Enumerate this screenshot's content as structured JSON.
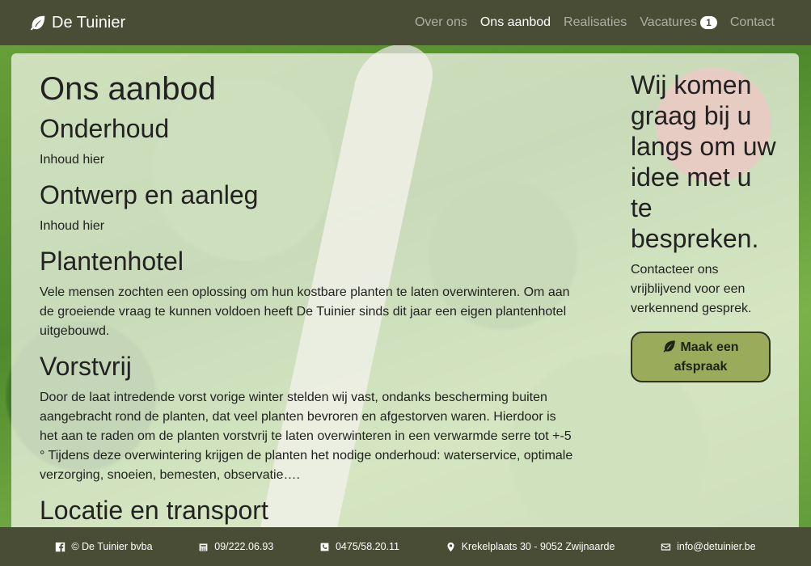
{
  "brand": {
    "name": "De Tuinier",
    "icon": "leaf-icon"
  },
  "nav": {
    "items": [
      {
        "label": "Over ons"
      },
      {
        "label": "Ons aanbod"
      },
      {
        "label": "Realisaties"
      },
      {
        "label": "Vacatures",
        "badge": "1"
      },
      {
        "label": "Contact"
      }
    ]
  },
  "main": {
    "title": "Ons aanbod",
    "sections": [
      {
        "heading": "Onderhoud",
        "text": "Inhoud hier"
      },
      {
        "heading": "Ontwerp en aanleg",
        "text": "Inhoud hier"
      },
      {
        "heading": "Plantenhotel",
        "text": "Vele mensen zochten een oplossing om hun kostbare planten te laten overwinteren. Om aan de groeiende vraag te kunnen voldoen heeft De Tuinier sinds dit jaar een eigen plantenhotel uitgebouwd."
      },
      {
        "heading": "Vorstvrij",
        "text": "Door de laat intredende vorst vorige winter stelden wij vast, ondanks bescherming buiten aangebracht rond de planten, dat veel planten bevroren en afgestorven waren. Hierdoor is het aan te raden om de planten vorstvrij te laten overwinteren in een verwarmde serre tot +-5 ° Tijdens deze overwintering krijgen de planten het nodige onderhoud: waterservice, optimale verzorging, snoeien, bemesten, observatie…."
      },
      {
        "heading": "Locatie en transport"
      }
    ]
  },
  "aside": {
    "heading": "Wij komen graag bij u langs om uw idee met u te bespreken.",
    "text": "Contacteer ons vrijblijvend voor een verkennend gesprek.",
    "cta_label": "Maak een afspraak"
  },
  "footer": {
    "company": "© De Tuinier bvba",
    "phone": "09/222.06.93",
    "mobile": "0475/58.20.11",
    "address": "Krekelplaats 30 - 9052 Zwijnaarde",
    "email": "info@detuinier.be"
  }
}
